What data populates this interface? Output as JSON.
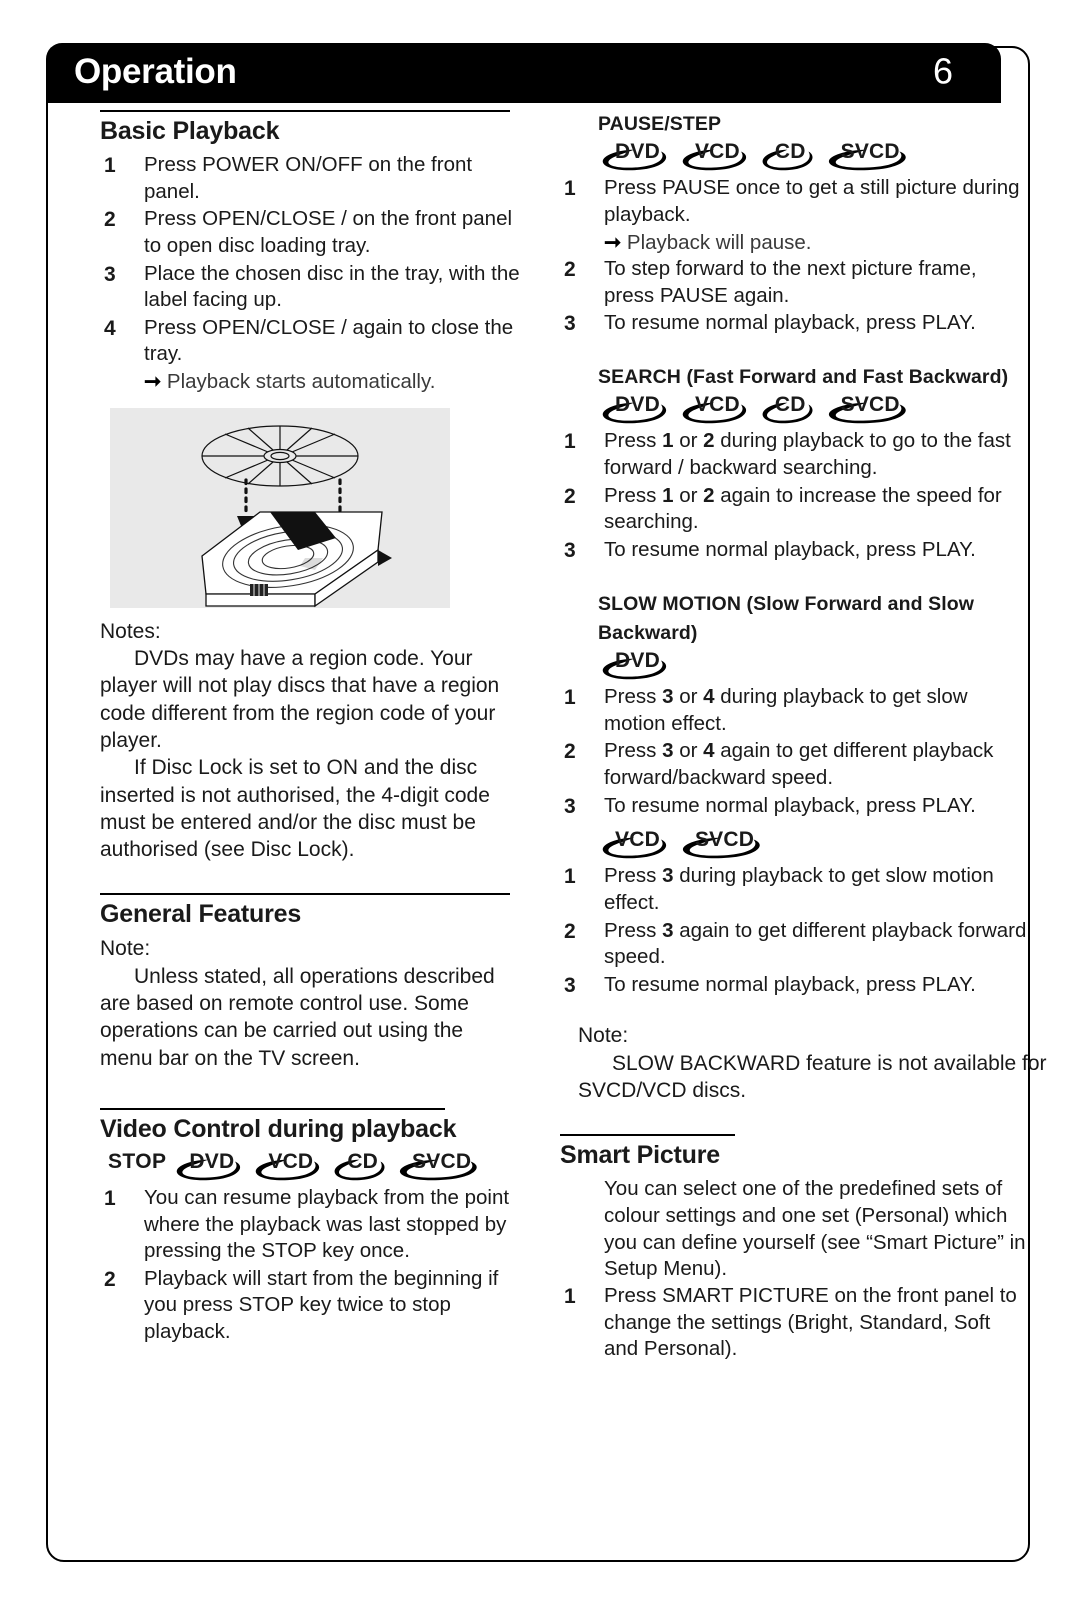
{
  "header": {
    "title": "Operation",
    "page_number": "6"
  },
  "left_column": {
    "basic_playback": {
      "heading": "Basic Playback",
      "steps": [
        {
          "num": "1",
          "text": "Press POWER ON/OFF on the front panel."
        },
        {
          "num": "2",
          "text": "Press OPEN/CLOSE /   on the front panel to open disc loading tray."
        },
        {
          "num": "3",
          "text": "Place the chosen disc in the tray, with the label facing up."
        },
        {
          "num": "4",
          "text": "Press OPEN/CLOSE /   again to close the tray."
        }
      ],
      "arrow_note": "Playback starts automatically.",
      "illustration_name": "disc-loading-tray-illustration"
    },
    "notes": {
      "heading": "Notes:",
      "paragraphs": [
        "DVDs may have a region code. Your player will not play discs that have a region code different from the region code of  your player.",
        "If Disc Lock is set to ON and the disc inserted is not authorised, the 4-digit code must be entered and/or the disc must be authorised (see Disc Lock)."
      ]
    },
    "general_features": {
      "heading": "General Features",
      "note_heading": "Note:",
      "note_text": "Unless stated, all operations described are based on remote control use. Some operations can be carried out using the menu bar on the TV screen."
    },
    "video_control": {
      "heading": "Video Control during playback",
      "stop_label": "STOP",
      "discs": [
        "DVD",
        "VCD",
        "CD",
        "SVCD"
      ],
      "steps": [
        {
          "num": "1",
          "text": "You can resume playback from the point where the playback was last stopped by pressing the STOP key once."
        },
        {
          "num": "2",
          "text": "Playback will start from the beginning if you press STOP key twice to stop playback."
        }
      ]
    }
  },
  "right_column": {
    "pause_step": {
      "heading": "PAUSE/STEP",
      "discs": [
        "DVD",
        "VCD",
        "CD",
        "SVCD"
      ],
      "steps": [
        {
          "num": "1",
          "text": "Press PAUSE once to get a still picture during playback."
        },
        {
          "num": "2",
          "text": "To step forward to the next picture frame, press PAUSE again."
        },
        {
          "num": "3",
          "text": "To resume normal playback, press PLAY."
        }
      ],
      "arrow_note": "Playback will pause."
    },
    "search": {
      "heading": "SEARCH (Fast Forward and Fast Backward)",
      "discs": [
        "DVD",
        "VCD",
        "CD",
        "SVCD"
      ],
      "steps": [
        {
          "num": "1",
          "pre": "Press ",
          "key1": "1",
          "mid": " or ",
          "key2": "2",
          "post": " during playback to go to the fast forward / backward searching."
        },
        {
          "num": "2",
          "pre": "Press ",
          "key1": "1",
          "mid": " or ",
          "key2": "2",
          "post": " again to increase the speed for searching."
        },
        {
          "num": "3",
          "pre": "To resume normal playback, press PLAY.",
          "key1": "",
          "mid": "",
          "key2": "",
          "post": ""
        }
      ]
    },
    "slow_motion": {
      "heading": "SLOW MOTION (Slow Forward and Slow Backward)",
      "discs_dvd": [
        "DVD"
      ],
      "dvd_steps": [
        {
          "num": "1",
          "pre": "Press ",
          "key1": "3",
          "mid": " or ",
          "key2": "4",
          "post": " during playback to get slow motion effect."
        },
        {
          "num": "2",
          "pre": "Press ",
          "key1": "3",
          "mid": " or ",
          "key2": "4",
          "post": " again to get different playback forward/backward speed."
        },
        {
          "num": "3",
          "pre": "To resume normal playback, press PLAY.",
          "key1": "",
          "mid": "",
          "key2": "",
          "post": ""
        }
      ],
      "discs_vcd": [
        "VCD",
        "SVCD"
      ],
      "vcd_steps": [
        {
          "num": "1",
          "pre": "Press ",
          "key1": "3",
          "mid": "",
          "key2": "",
          "post": " during playback to get slow motion effect."
        },
        {
          "num": "2",
          "pre": "Press ",
          "key1": "3",
          "mid": "",
          "key2": "",
          "post": " again to get different playback forward speed."
        },
        {
          "num": "3",
          "pre": "To resume normal playback, press PLAY.",
          "key1": "",
          "mid": "",
          "key2": "",
          "post": ""
        }
      ],
      "note_heading": "Note:",
      "note_text": "SLOW BACKWARD feature is not available for SVCD/VCD discs."
    },
    "smart_picture": {
      "heading": "Smart Picture",
      "intro": "You can select one of the predefined sets of colour settings and one set (Personal) which you can define yourself (see “Smart Picture” in Setup Menu).",
      "steps": [
        {
          "num": "1",
          "text": "Press SMART PICTURE on the front panel to change the settings (Bright, Standard, Soft and Personal)."
        }
      ]
    }
  }
}
